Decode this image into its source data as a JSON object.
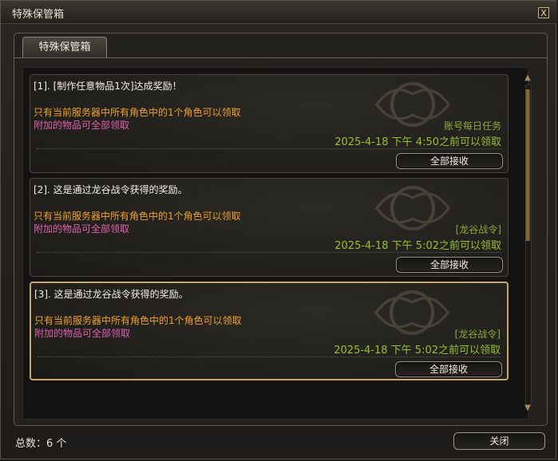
{
  "window": {
    "title": "特殊保管箱",
    "close_glyph": "X"
  },
  "tab": {
    "label": "特殊保管箱"
  },
  "rewards": [
    {
      "title": "[1]. [制作任意物品1次]达成奖励！",
      "line1": "只有当前服务器中所有角色中的1个角色可以领取",
      "line2": "附加的物品可全部领取",
      "source": "账号每日任务",
      "expire": "2025-4-18 下午 4:50之前可以领取",
      "button": "全部接收"
    },
    {
      "title": "[2]. 这是通过龙谷战令获得的奖励。",
      "line1": "只有当前服务器中所有角色中的1个角色可以领取",
      "line2": "附加的物品可全部领取",
      "source": "[龙谷战令]",
      "expire": "2025-4-18 下午 5:02之前可以领取",
      "button": "全部接收"
    },
    {
      "title": "[3]. 这是通过龙谷战令获得的奖励。",
      "line1": "只有当前服务器中所有角色中的1个角色可以领取",
      "line2": "附加的物品可全部领取",
      "source": "[龙谷战令]",
      "expire": "2025-4-18 下午 5:02之前可以领取",
      "button": "全部接收"
    }
  ],
  "footer": {
    "count": "总数：6 个",
    "close_button": "关闭"
  }
}
